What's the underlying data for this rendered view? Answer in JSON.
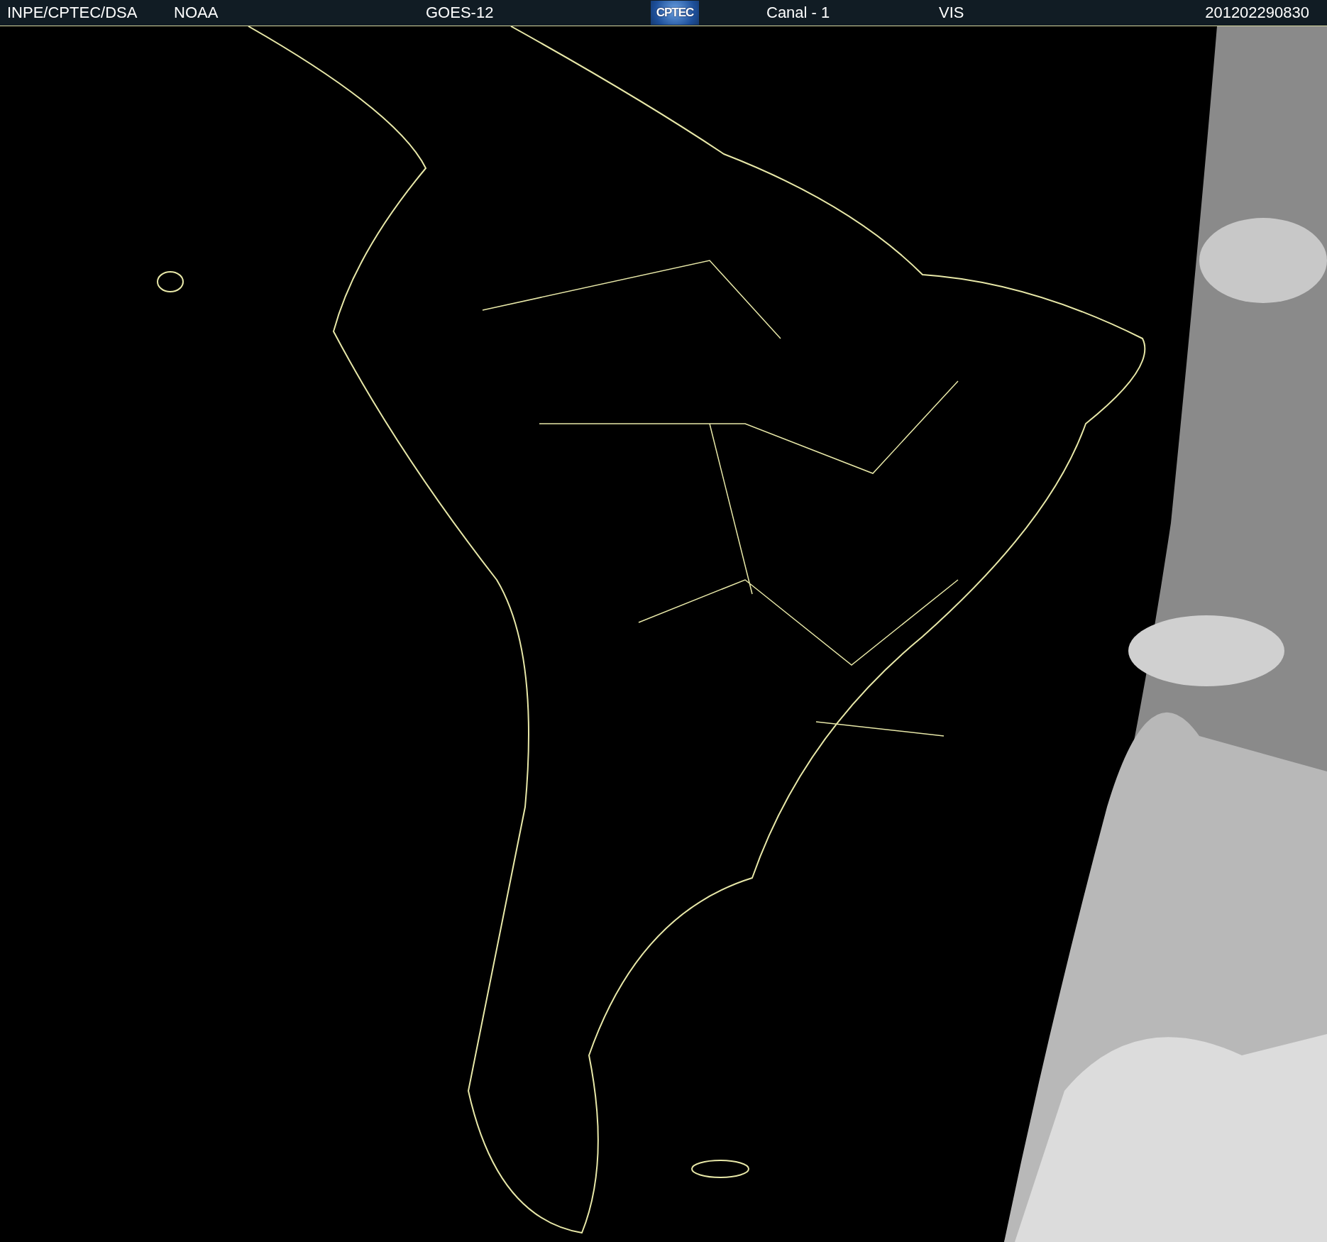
{
  "header": {
    "source": "INPE/CPTEC/DSA",
    "agency": "NOAA",
    "satellite": "GOES-12",
    "logo": "CPTEC",
    "channel": "Canal - 1",
    "band": "VIS",
    "timestamp": "201202290830"
  }
}
